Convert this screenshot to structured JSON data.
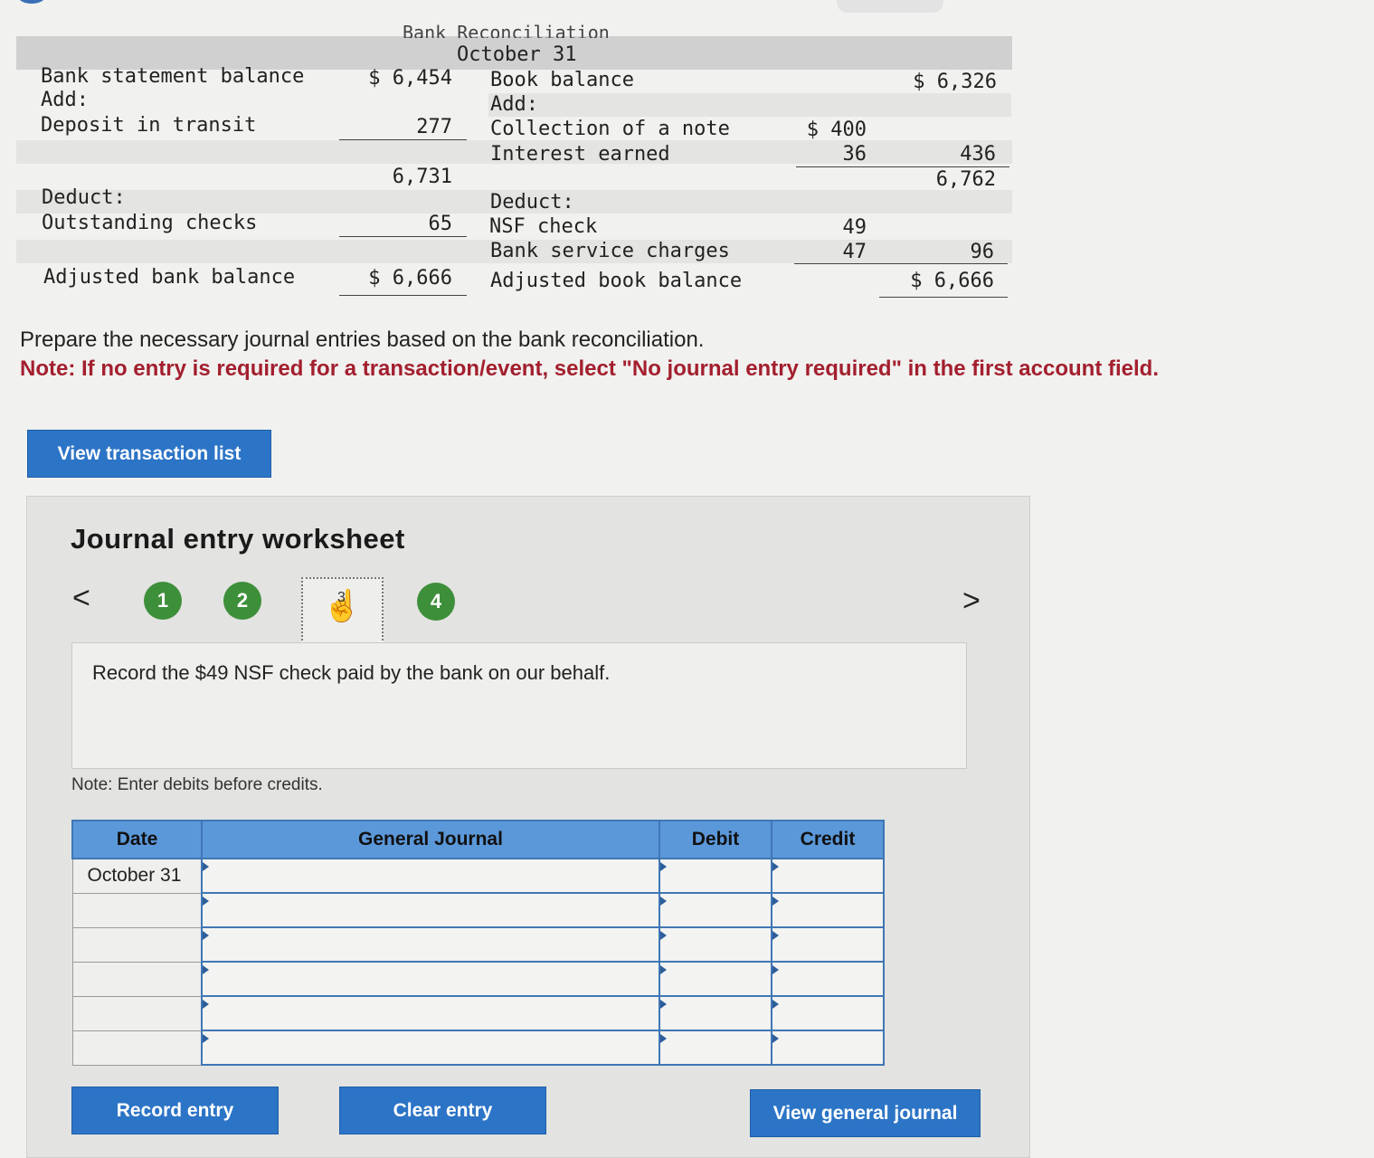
{
  "recon": {
    "title_partial": "Bank Reconciliation",
    "date": "October 31",
    "left": {
      "bank_statement_label": "Bank statement balance",
      "bank_statement_value": "$ 6,454",
      "add_label": "Add:",
      "deposit_label": "Deposit in transit",
      "deposit_value": "277",
      "subtotal_value": "6,731",
      "deduct_label": "Deduct:",
      "outstanding_label": "Outstanding checks",
      "outstanding_value": "65",
      "adjusted_label": "Adjusted bank balance",
      "adjusted_value": "$ 6,666"
    },
    "right": {
      "book_balance_label": "Book balance",
      "book_balance_value": "$ 6,326",
      "add_label": "Add:",
      "collection_label": "Collection of a note",
      "collection_value": "$ 400",
      "interest_label": "Interest earned",
      "interest_value": "36",
      "add_total": "436",
      "subtotal_value": "6,762",
      "deduct_label": "Deduct:",
      "nsf_label": "NSF check",
      "nsf_value": "49",
      "service_label": "Bank service charges",
      "service_value": "47",
      "deduct_total": "96",
      "adjusted_label": "Adjusted book balance",
      "adjusted_value": "$ 6,666"
    }
  },
  "instructions": {
    "line1": "Prepare the necessary journal entries based on the bank reconciliation.",
    "note": "Note: If no entry is required for a transaction/event, select \"No journal entry required\" in the first account field."
  },
  "buttons": {
    "view_transaction_list": "View transaction list",
    "record_entry": "Record entry",
    "clear_entry": "Clear entry",
    "view_general_journal": "View general journal"
  },
  "worksheet": {
    "title": "Journal entry worksheet",
    "steps": [
      "1",
      "2",
      "3",
      "4"
    ],
    "active_step": "3",
    "prev_arrow": "<",
    "next_arrow": ">",
    "instruction": "Record the $49 NSF check paid by the bank on our behalf.",
    "debit_note": "Note: Enter debits before credits."
  },
  "journal": {
    "headers": {
      "date": "Date",
      "general_journal": "General Journal",
      "debit": "Debit",
      "credit": "Credit"
    },
    "rows": [
      {
        "date": "October 31",
        "account": "",
        "debit": "",
        "credit": ""
      },
      {
        "date": "",
        "account": "",
        "debit": "",
        "credit": ""
      },
      {
        "date": "",
        "account": "",
        "debit": "",
        "credit": ""
      },
      {
        "date": "",
        "account": "",
        "debit": "",
        "credit": ""
      },
      {
        "date": "",
        "account": "",
        "debit": "",
        "credit": ""
      },
      {
        "date": "",
        "account": "",
        "debit": "",
        "credit": ""
      }
    ]
  },
  "colors": {
    "button_blue": "#2c74c6",
    "header_blue": "#5b98d9",
    "step_green": "#3e8f3a",
    "note_red": "#a31f2e"
  }
}
